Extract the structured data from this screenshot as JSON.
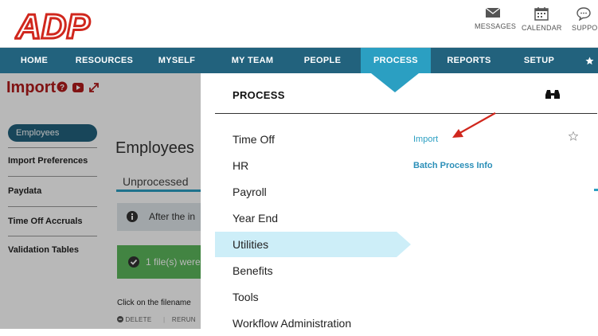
{
  "header": {
    "logo_text": "ADP",
    "buttons": [
      {
        "label": "MESSAGES",
        "icon": "envelope-icon"
      },
      {
        "label": "CALENDAR",
        "icon": "calendar-icon"
      },
      {
        "label": "SUPPO",
        "icon": "chat-bubble-icon"
      }
    ]
  },
  "nav": {
    "items": [
      "HOME",
      "RESOURCES",
      "MYSELF",
      "MY TEAM",
      "PEOPLE",
      "PROCESS",
      "REPORTS",
      "SETUP"
    ],
    "active": "PROCESS",
    "star_icon": "star-icon"
  },
  "page": {
    "title": "Import",
    "heading": "Employees",
    "tab": "Unprocessed",
    "info_text": "After the in",
    "success_text": "1 file(s) were",
    "click_note": "Click on the filename",
    "actions": [
      "DELETE",
      "RERUN"
    ]
  },
  "sidebar": {
    "items": [
      "Employees",
      "Import Preferences",
      "Paydata",
      "Time Off Accruals",
      "Validation Tables"
    ],
    "active": "Employees"
  },
  "flyout": {
    "title": "PROCESS",
    "menu": [
      "Time Off",
      "HR",
      "Payroll",
      "Year End",
      "Utilities",
      "Benefits",
      "Tools",
      "Workflow Administration"
    ],
    "active": "Utilities",
    "submenu": [
      "Import",
      "Batch Process Info"
    ]
  },
  "colors": {
    "nav_bg": "#22627d",
    "nav_active": "#2b9fc2",
    "brand_red": "#d0271d",
    "menu_highlight": "#cdeef8",
    "link": "#2b9fc2",
    "success": "#5cb85c"
  }
}
